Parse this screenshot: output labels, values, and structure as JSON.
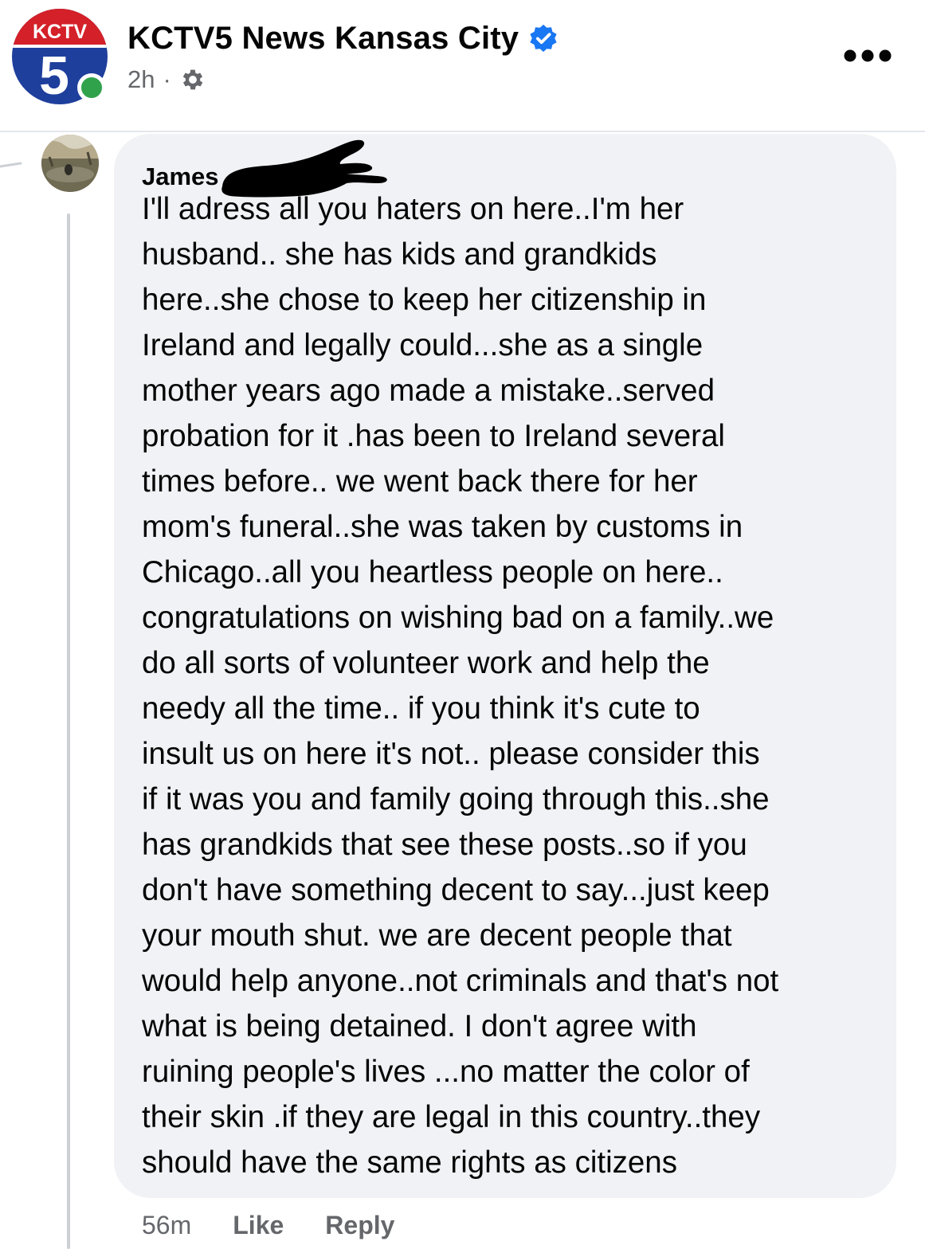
{
  "post": {
    "page_name": "KCTV5 News Kansas City",
    "logo_text": "KCTV",
    "logo_number": "5",
    "timestamp": "2h",
    "separator": "·",
    "verified": true,
    "colors": {
      "logo_red": "#d42028",
      "logo_blue": "#1f3f9c",
      "verified_blue": "#1877f2",
      "online_green": "#31a24c"
    },
    "icons": [
      "verified-badge-icon",
      "settings-gear-icon",
      "more-options-icon"
    ]
  },
  "comment": {
    "author": "James",
    "text": "I'll adress all you haters on here..I'm her\nhusband.. she has kids and grandkids\nhere..she chose to keep her citizenship in\nIreland and legally could...she as a single\nmother years ago made a mistake..served\nprobation for it .has been to Ireland several\ntimes before.. we went back there for her\nmom's funeral..she was taken by customs in\nChicago..all you heartless people on here..\ncongratulations on wishing bad on a family..we\ndo all sorts of volunteer work and help the\nneedy all the time.. if you think it's cute to\ninsult us on here it's not.. please consider this\nif it was you and family going through this..she\nhas grandkids that see these posts..so if you\ndon't have something decent to say...just keep\nyour mouth shut.  we are decent people that\nwould help anyone..not criminals and that's not\nwhat is being detained. I don't agree with\nruining people's lives ...no matter the color of\ntheir skin .if they are legal in this country..they\nshould have the same rights as citizens",
    "time": "56m",
    "like_label": "Like",
    "reply_label": "Reply"
  }
}
